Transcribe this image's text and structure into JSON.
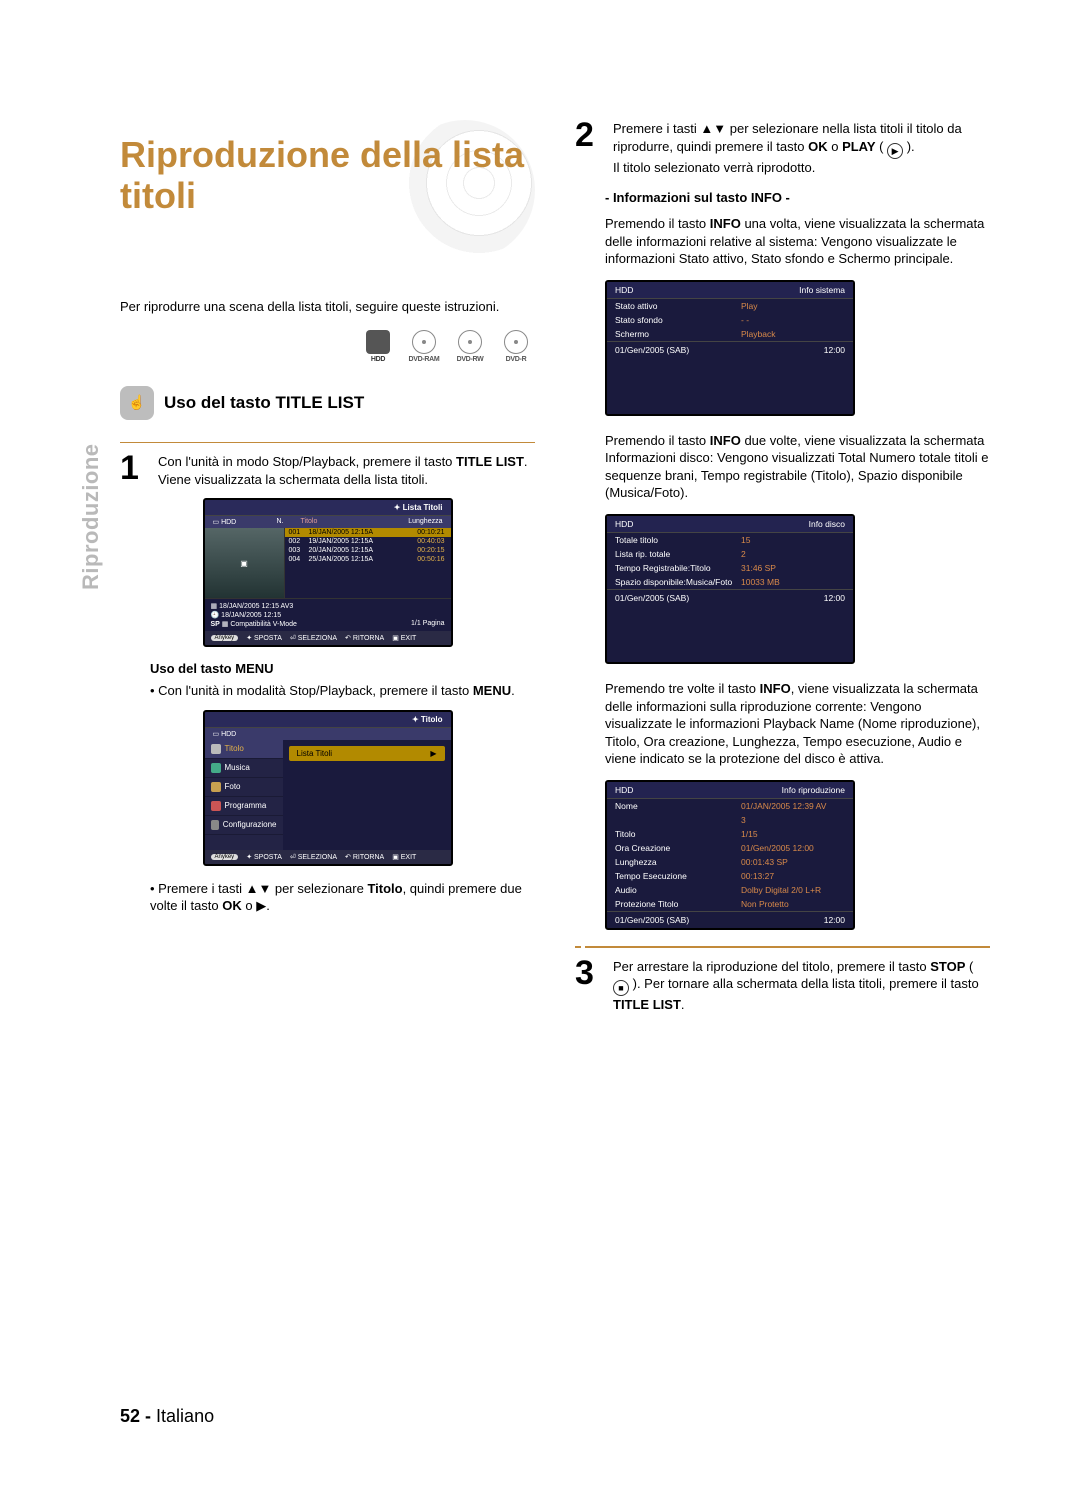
{
  "vertical_tab": "Riproduzione",
  "title": "Riproduzione della lista titoli",
  "intro": "Per riprodurre una scena della lista titoli, seguire queste istruzioni.",
  "media_icons": [
    "HDD",
    "DVD-RAM",
    "DVD-RW",
    "DVD-R"
  ],
  "section_heading": "Uso del tasto TITLE LIST",
  "step1": {
    "num": "1",
    "line1_a": "Con l'unità in modo Stop/Playback, premere il tasto ",
    "line1_b": "TITLE LIST",
    "line1_c": ".",
    "line2": "Viene visualizzata la schermata della lista titoli."
  },
  "title_list_osd": {
    "corner_title": "Lista Titoli",
    "hdd": "HDD",
    "cols": {
      "n": "N.",
      "titolo": "Titolo",
      "lung": "Lunghezza"
    },
    "rows": [
      {
        "n": "001",
        "t": "18/JAN/2005 12:15A",
        "l": "00:10:21"
      },
      {
        "n": "002",
        "t": "19/JAN/2005 12:15A",
        "l": "00:40:03"
      },
      {
        "n": "003",
        "t": "20/JAN/2005 12:15A",
        "l": "00:20:15"
      },
      {
        "n": "004",
        "t": "25/JAN/2005 12:15A",
        "l": "00:50:16"
      }
    ],
    "meta1": "18/JAN/2005 12:15 AV3",
    "meta2": "18/JAN/2005 12:15",
    "meta3a": "SP",
    "meta3b": "Compatibilità V-Mode",
    "page": "1/1 Pagina",
    "foot": [
      "SPOSTA",
      "SELEZIONA",
      "RITORNA",
      "EXIT"
    ],
    "anykey": "Anykey"
  },
  "menu_heading": "Uso del tasto MENU",
  "menu_bullet_a": "Con l'unità in modalità Stop/Playback, premere il tasto ",
  "menu_bullet_b": "MENU",
  "menu_bullet_c": ".",
  "menu_osd": {
    "corner_title": "Titolo",
    "hdd": "HDD",
    "items": [
      "Titolo",
      "Musica",
      "Foto",
      "Programma",
      "Configurazione"
    ],
    "selected": "Lista Titoli",
    "foot": [
      "SPOSTA",
      "SELEZIONA",
      "RITORNA",
      "EXIT"
    ],
    "anykey": "Anykey"
  },
  "menu_bullet2_a": "Premere i tasti ▲▼ per selezionare ",
  "menu_bullet2_b": "Titolo",
  "menu_bullet2_c": ", quindi premere due volte il tasto ",
  "menu_bullet2_d": "OK",
  "menu_bullet2_e": " o ▶.",
  "step2": {
    "num": "2",
    "a": "Premere i tasti ▲▼ per selezionare nella lista titoli il titolo da riprodurre, quindi premere il tasto ",
    "b": "OK",
    "c": " o ",
    "d": "PLAY",
    "e": " ( ",
    "f": " ).",
    "g": "Il titolo selezionato verrà riprodotto."
  },
  "info_heading": "- Informazioni sul tasto INFO -",
  "info_p1_a": "Premendo il tasto ",
  "info_p1_b": "INFO",
  "info_p1_c": " una volta, viene visualizzata la schermata delle informazioni relative al sistema: Vengono visualizzate le informazioni Stato attivo, Stato sfondo e Schermo principale.",
  "info_sys": {
    "hdd": "HDD",
    "label": "Info sistema",
    "rows": [
      {
        "k": "Stato attivo",
        "v": "Play"
      },
      {
        "k": "Stato sfondo",
        "v": "- -"
      },
      {
        "k": "Schermo",
        "v": "Playback"
      }
    ],
    "foot_l": "01/Gen/2005 (SAB)",
    "foot_r": "12:00"
  },
  "info_p2_a": "Premendo il tasto ",
  "info_p2_b": "INFO",
  "info_p2_c": " due volte, viene visualizzata la schermata Informazioni disco: Vengono visualizzati Total Numero totale titoli e sequenze brani, Tempo registrabile (Titolo), Spazio disponibile (Musica/Foto).",
  "info_disc": {
    "hdd": "HDD",
    "label": "Info disco",
    "rows": [
      {
        "k": "Totale titolo",
        "v": "15"
      },
      {
        "k": "Lista rip. totale",
        "v": "2"
      },
      {
        "k": "Tempo Registrabile:Titolo",
        "v": "31:46  SP"
      },
      {
        "k": "Spazio disponibile:Musica/Foto",
        "v": "10033 MB"
      }
    ],
    "foot_l": "01/Gen/2005 (SAB)",
    "foot_r": "12:00"
  },
  "info_p3_a": "Premendo tre volte il tasto ",
  "info_p3_b": "INFO",
  "info_p3_c": ", viene visualizzata la schermata delle informazioni sulla riproduzione corrente: Vengono visualizzate le informazioni Playback Name (Nome riproduzione), Titolo, Ora creazione, Lunghezza, Tempo esecuzione, Audio e viene indicato se la protezione del disco è attiva.",
  "info_play": {
    "hdd": "HDD",
    "label": "Info riproduzione",
    "rows": [
      {
        "k": "Nome",
        "v": "01/JAN/2005 12:39 AV"
      },
      {
        "k": "",
        "v": "3"
      },
      {
        "k": "Titolo",
        "v": "1/15"
      },
      {
        "k": "Ora Creazione",
        "v": "01/Gen/2005 12:00"
      },
      {
        "k": "Lunghezza",
        "v": "00:01:43 SP"
      },
      {
        "k": "Tempo Esecuzione",
        "v": "00:13:27"
      },
      {
        "k": "Audio",
        "v": "Dolby Digital 2/0 L+R"
      },
      {
        "k": "Protezione Titolo",
        "v": "Non Protetto"
      }
    ],
    "foot_l": "01/Gen/2005 (SAB)",
    "foot_r": "12:00"
  },
  "step3": {
    "num": "3",
    "a": "Per arrestare la riproduzione del titolo, premere il tasto ",
    "b": "STOP",
    "c": " ( ",
    "d": " ). Per tornare alla schermata della lista titoli, premere il tasto ",
    "e": "TITLE LIST",
    "f": "."
  },
  "footer": {
    "page": "52 -",
    "lang": "Italiano"
  }
}
